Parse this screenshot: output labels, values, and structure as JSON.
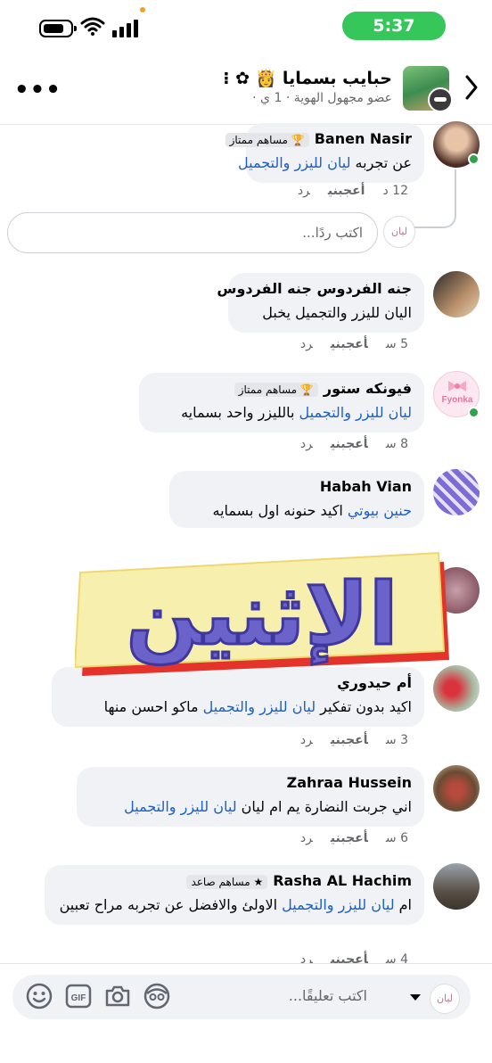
{
  "status_bar": {
    "time": "5:37"
  },
  "header": {
    "title": "حبايب بسمايا 👸 ✿ ⁝",
    "subtitle": "عضو مجهول الهوية · 1 ي ·"
  },
  "comments": [
    {
      "name": "Banen Nasir",
      "badge": "🏆 مساهم ممتاز",
      "text_prefix": "عن تجربه ",
      "link": "ليان لليزر والتجميل",
      "text_suffix": "",
      "time": "12 د",
      "like": "أعجبني",
      "reply": "رد"
    },
    {
      "name": "جنه الفردوس جنه الفردوس",
      "badge": "",
      "text_prefix": "اليان لليزر والتجميل يخبل",
      "link": "",
      "text_suffix": "",
      "time": "5 س",
      "like": "أعجبني",
      "reply": "رد"
    },
    {
      "name": "فيونكه ستور",
      "badge": "🏆 مساهم ممتاز",
      "text_prefix": "",
      "link": "ليان لليزر والتجميل",
      "text_suffix": " بالليزر واحد بسمايه",
      "time": "8 س",
      "like": "أعجبني",
      "reply": "رد"
    },
    {
      "name": "Habah Vian",
      "badge": "",
      "text_prefix": "",
      "link": "حنين بيوتي",
      "text_suffix": " اكيد حنونه اول بسمايه",
      "time": "",
      "like": "",
      "reply": ""
    },
    {
      "name": "أم حيدوري",
      "badge": "",
      "text_prefix": "اكيد بدون تفكير ",
      "link": "ليان لليزر والتجميل",
      "text_suffix": " ماكو احسن منها",
      "time": "3 س",
      "like": "أعجبني",
      "reply": "رد"
    },
    {
      "name": "Zahraa Hussein",
      "badge": "",
      "text_prefix": "اني جربت النضارة يم ام ليان  ",
      "link": "ليان لليزر والتجميل",
      "text_suffix": "",
      "time": "6 س",
      "like": "أعجبني",
      "reply": "رد"
    },
    {
      "name": "Rasha AL Hachim",
      "badge": "★ مساهم صاعد",
      "text_prefix": "ام ",
      "link": "ليان لليزر والتجميل",
      "text_suffix": " الاولئ والافضل  عن تجربه مراح تعبين",
      "time": "4 س",
      "like": "أعجبني",
      "reply": "رد"
    }
  ],
  "reply_box": {
    "placeholder": "اكتب ردًا..."
  },
  "sticker_text": "الإثنين",
  "fyonka_logo": "Fyonka",
  "avatar_logo": "ليان",
  "bottom_bar": {
    "placeholder": "اكتب تعليقًا..."
  },
  "colors": {
    "link": "#1b5fc7",
    "online": "#31a24c",
    "bubble": "#f0f2f5",
    "sticker_fill": "#6b63c9",
    "sticker_bg": "#f7efad",
    "sticker_shadow": "#e3332a"
  }
}
